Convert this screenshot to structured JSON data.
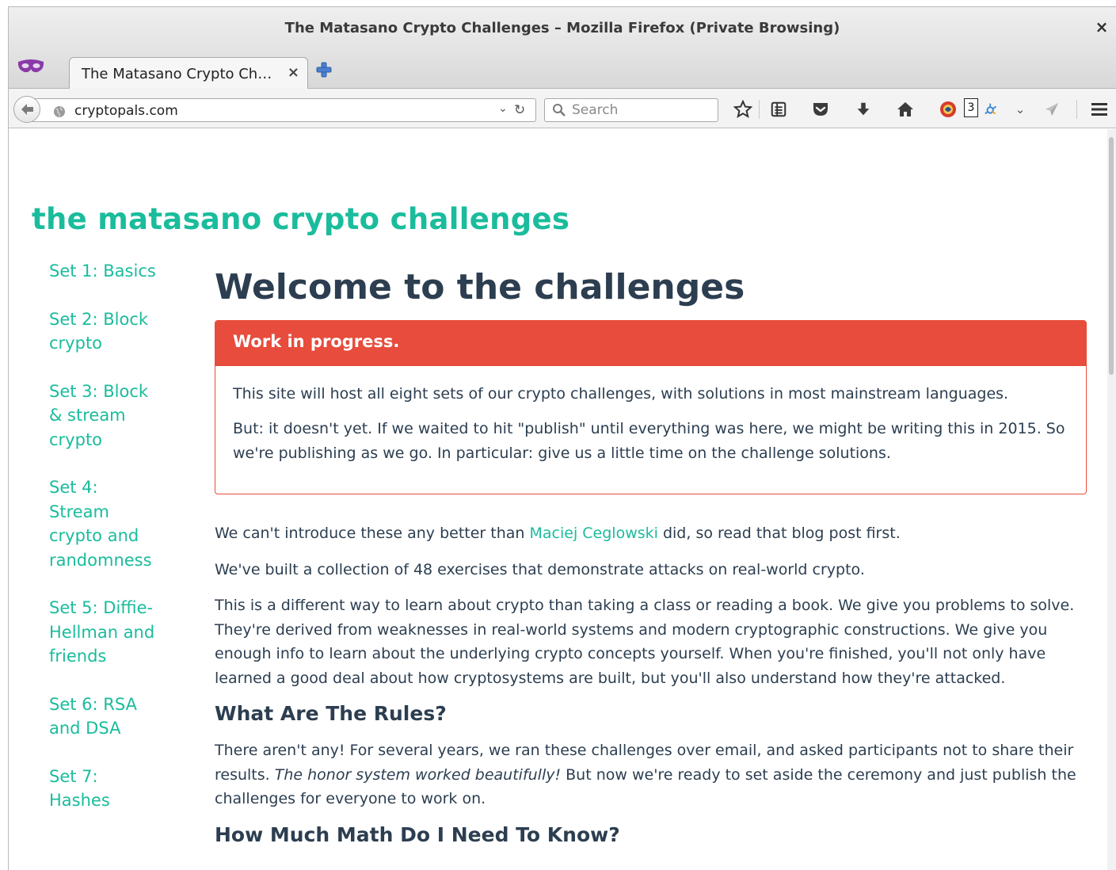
{
  "window": {
    "title": "The Matasano Crypto Challenges – Mozilla Firefox (Private Browsing)",
    "close_glyph": "×"
  },
  "tab": {
    "label": "The Matasano Crypto Ch…",
    "close_glyph": "×"
  },
  "navbar": {
    "url": "cryptopals.com",
    "search_placeholder": "Search",
    "badge_count": "3"
  },
  "site": {
    "title": "the matasano crypto challenges"
  },
  "sidebar": {
    "items": [
      {
        "label": "Set 1: Basics"
      },
      {
        "label": "Set 2: Block crypto"
      },
      {
        "label": "Set 3: Block & stream crypto"
      },
      {
        "label": "Set 4: Stream crypto and randomness"
      },
      {
        "label": "Set 5: Diffie-Hellman and friends"
      },
      {
        "label": "Set 6: RSA and DSA"
      },
      {
        "label": "Set 7: Hashes"
      }
    ]
  },
  "main": {
    "title": "Welcome to the challenges",
    "notice": {
      "heading": "Work in progress.",
      "p1": "This site will host all eight sets of our crypto challenges, with solutions in most mainstream languages.",
      "p2": "But: it doesn't yet. If we waited to hit \"publish\" until everything was here, we might be writing this in 2015. So we're publishing as we go. In particular: give us a little time on the challenge solutions."
    },
    "intro_before": "We can't introduce these any better than ",
    "intro_link": "Maciej Ceglowski",
    "intro_after": " did, so read that blog post first.",
    "p_collection": "We've built a collection of 48 exercises that demonstrate attacks on real-world crypto.",
    "p_different": "This is a different way to learn about crypto than taking a class or reading a book. We give you problems to solve. They're derived from weaknesses in real-world systems and modern cryptographic constructions. We give you enough info to learn about the underlying crypto concepts yourself. When you're finished, you'll not only have learned a good deal about how cryptosystems are built, but you'll also understand how they're attacked.",
    "rules_heading": "What Are The Rules?",
    "rules_before": "There aren't any! For several years, we ran these challenges over email, and asked participants not to share their results. ",
    "rules_em": "The honor system worked beautifully!",
    "rules_after": " But now we're ready to set aside the ceremony and just publish the challenges for everyone to work on.",
    "next_heading": "How Much Math Do I Need To Know?"
  },
  "colors": {
    "accent": "#1abc9c",
    "heading": "#2c3e50",
    "alert": "#e74c3c"
  },
  "icons": [
    "private-mask-icon",
    "new-tab-plus-icon",
    "back-arrow-icon",
    "globe-icon",
    "dropdown-chevron-icon",
    "reload-icon",
    "search-icon",
    "bookmark-star-icon",
    "reading-list-icon",
    "pocket-icon",
    "download-arrow-icon",
    "home-icon",
    "extension-red-icon",
    "extension-badge-icon",
    "extension-chevron-icon",
    "send-arrow-icon",
    "hamburger-menu-icon"
  ]
}
